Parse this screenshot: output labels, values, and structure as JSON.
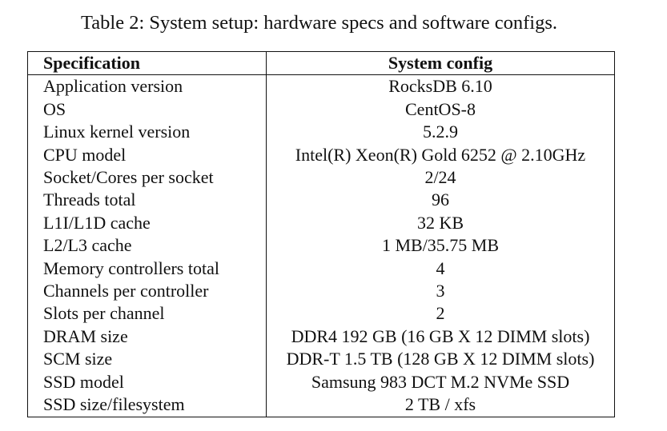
{
  "caption": "Table 2: System setup: hardware specs and software configs.",
  "table": {
    "headers": [
      "Specification",
      "System config"
    ],
    "rows": [
      [
        "Application version",
        "RocksDB 6.10"
      ],
      [
        "OS",
        "CentOS-8"
      ],
      [
        "Linux kernel version",
        "5.2.9"
      ],
      [
        "CPU model",
        "Intel(R) Xeon(R) Gold 6252 @ 2.10GHz"
      ],
      [
        "Socket/Cores per socket",
        "2/24"
      ],
      [
        "Threads total",
        "96"
      ],
      [
        "L1I/L1D cache",
        "32 KB"
      ],
      [
        "L2/L3 cache",
        "1 MB/35.75 MB"
      ],
      [
        "Memory controllers total",
        "4"
      ],
      [
        "Channels per controller",
        "3"
      ],
      [
        "Slots per channel",
        "2"
      ],
      [
        "DRAM size",
        "DDR4 192 GB (16 GB X 12 DIMM slots)"
      ],
      [
        "SCM size",
        "DDR-T 1.5 TB (128 GB X 12 DIMM slots)"
      ],
      [
        "SSD model",
        "Samsung 983 DCT M.2 NVMe SSD"
      ],
      [
        "SSD size/filesystem",
        "2 TB / xfs"
      ]
    ]
  }
}
